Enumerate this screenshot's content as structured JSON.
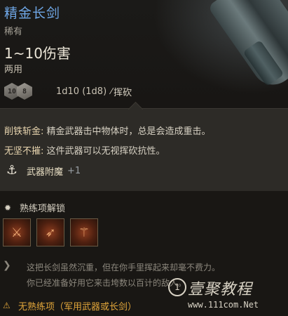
{
  "item": {
    "name": "精金长剑",
    "rarity": "稀有",
    "damage": "1~10伤害",
    "handedness": "两用",
    "dice": [
      "10",
      "8"
    ],
    "dice_text": "1d10 (1d8)",
    "damage_type": "挥砍"
  },
  "passives": [
    {
      "name": "削铁斩金:",
      "text": " 精金武器击中物体时，总是会造成重击。"
    },
    {
      "name": "无坚不摧:",
      "text": " 这件武器可以无视挥砍抗性。"
    }
  ],
  "enchantment": {
    "label": "武器附魔",
    "bonus": "+1"
  },
  "proficiency": {
    "title": "熟练项解锁",
    "skills": [
      "skill-1-icon",
      "skill-2-icon",
      "skill-3-icon"
    ]
  },
  "flavor": {
    "line1": "这把长剑虽然沉重，但在你手里挥起来却毫不费力。",
    "line2": "你已经准备好用它来击垮数以百计的敌人。"
  },
  "warning": "无熟练项（军用武器或长剑）",
  "watermark": {
    "title": "壹聚教程",
    "url": "www.111com.Net"
  }
}
